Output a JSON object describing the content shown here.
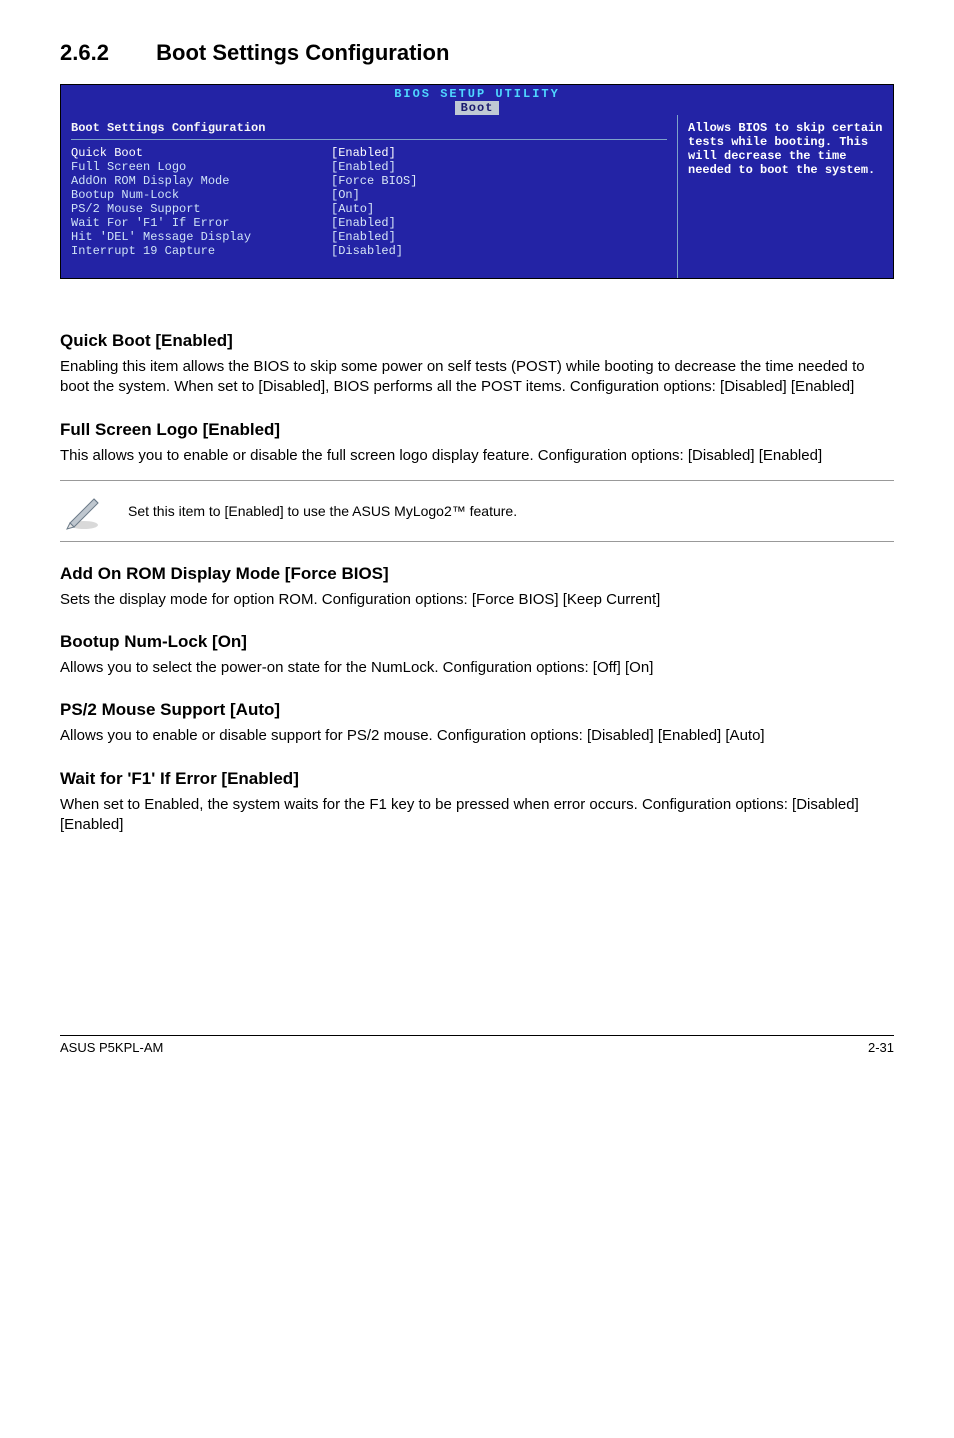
{
  "section": {
    "number": "2.6.2",
    "title": "Boot Settings Configuration"
  },
  "bios": {
    "header": "BIOS SETUP UTILITY",
    "tab": "Boot",
    "panel_title": "Boot Settings Configuration",
    "rows": [
      {
        "label": "Quick Boot",
        "value": "[Enabled]",
        "selected": true
      },
      {
        "label": "Full Screen Logo",
        "value": "[Enabled]",
        "selected": false
      },
      {
        "label": "AddOn ROM Display Mode",
        "value": "[Force BIOS]",
        "selected": false
      },
      {
        "label": "Bootup Num-Lock",
        "value": "[On]",
        "selected": false
      },
      {
        "label": "PS/2 Mouse Support",
        "value": "[Auto]",
        "selected": false
      },
      {
        "label": "Wait For 'F1' If Error",
        "value": "[Enabled]",
        "selected": false
      },
      {
        "label": "Hit 'DEL' Message Display",
        "value": "[Enabled]",
        "selected": false
      },
      {
        "label": "Interrupt 19 Capture",
        "value": "[Disabled]",
        "selected": false
      }
    ],
    "help": "Allows BIOS to skip certain tests while booting. This will decrease the time needed to boot the system."
  },
  "subsections": {
    "quick_boot": {
      "head": "Quick Boot [Enabled]",
      "body": "Enabling this item allows the BIOS to skip some power on self tests (POST) while booting to decrease the time needed to boot the system. When set to [Disabled], BIOS performs all the POST items. Configuration options: [Disabled] [Enabled]"
    },
    "full_screen_logo": {
      "head": "Full Screen Logo [Enabled]",
      "body": "This allows you to enable or disable the full screen logo display feature. Configuration options: [Disabled] [Enabled]"
    },
    "note": {
      "text": "Set this item to [Enabled] to use the ASUS MyLogo2™ feature."
    },
    "addon_rom": {
      "head": "Add On ROM Display Mode [Force BIOS]",
      "body": "Sets the display mode for option ROM. Configuration options: [Force BIOS] [Keep Current]"
    },
    "bootup_numlock": {
      "head": "Bootup Num-Lock [On]",
      "body": "Allows you to select the power-on state for the NumLock. Configuration options: [Off] [On]"
    },
    "ps2_mouse": {
      "head": "PS/2 Mouse Support [Auto]",
      "body": "Allows you to enable or disable support for PS/2 mouse. Configuration options: [Disabled] [Enabled] [Auto]"
    },
    "wait_f1": {
      "head": "Wait for 'F1' If Error [Enabled]",
      "body": "When set to Enabled, the system waits for the F1 key to be pressed when error occurs. Configuration options: [Disabled] [Enabled]"
    }
  },
  "footer": {
    "left": "ASUS P5KPL-AM",
    "right": "2-31"
  }
}
